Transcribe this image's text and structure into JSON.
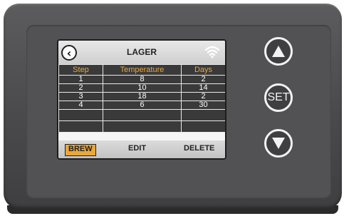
{
  "screen": {
    "title": "LAGER",
    "back_icon": "chevron-left-icon",
    "status_icon": "wifi-icon"
  },
  "table": {
    "headers": [
      "Step",
      "Temperature",
      "Days"
    ],
    "rows": [
      [
        "1",
        "8",
        "2"
      ],
      [
        "2",
        "10",
        "14"
      ],
      [
        "3",
        "18",
        "2"
      ],
      [
        "4",
        "6",
        "30"
      ],
      [
        "",
        "",
        ""
      ],
      [
        "",
        "",
        ""
      ]
    ]
  },
  "softkeys": {
    "brew": "BREW",
    "edit": "EDIT",
    "delete": "DELETE"
  },
  "hardware": {
    "up_icon": "triangle-up-icon",
    "set_label": "SET",
    "down_icon": "triangle-down-icon"
  },
  "colors": {
    "accent": "#e8a83a",
    "table_bg": "#3a3a3a",
    "device_body": "#4a4a4c"
  }
}
